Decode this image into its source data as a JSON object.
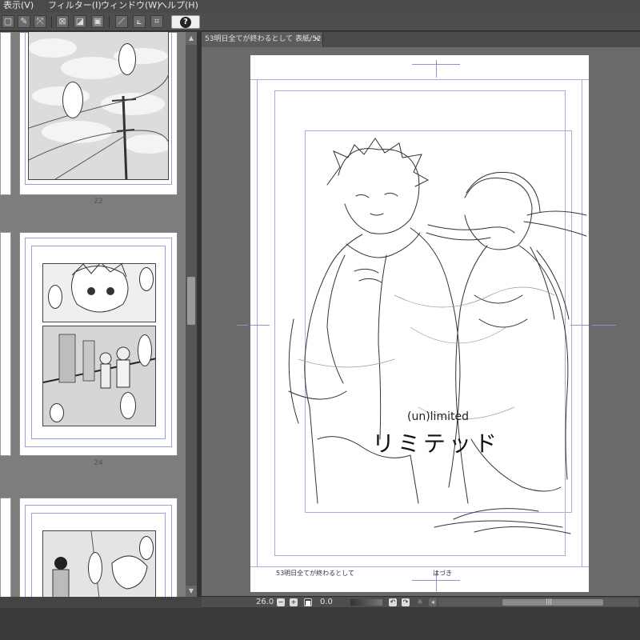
{
  "menu": {
    "items": [
      {
        "label": "表示(V)"
      },
      {
        "label": "フィルター(I)"
      },
      {
        "label": "ウィンドウ(W)"
      },
      {
        "label": "ヘルプ(H)"
      }
    ]
  },
  "toolbar": {
    "help_label": "?"
  },
  "page_manager": {
    "pages": [
      {
        "number": "22"
      },
      {
        "number": "24"
      }
    ]
  },
  "document": {
    "tab_label": "53明日全てが終わるとして 表紙/52",
    "close_label": "×",
    "cover_title_en": "(un)limited",
    "cover_title_jp": "リミテッド",
    "footer_left": "53明日全てが終わるとして",
    "footer_center": "はづき"
  },
  "status": {
    "zoom": "26.0",
    "angle": "0.0",
    "scroll_grip": "|||"
  },
  "colors": {
    "frame_guide": "#9aa0d8",
    "ui_dark": "#3a3a3a",
    "canvas_bg": "#6a6a6a"
  }
}
